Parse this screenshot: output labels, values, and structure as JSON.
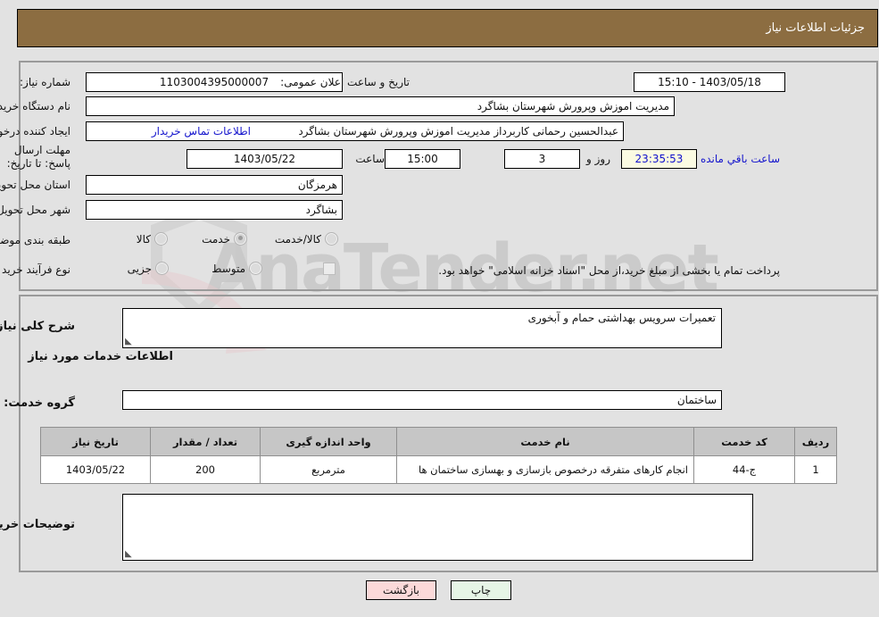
{
  "header": {
    "title": "جزئیات اطلاعات نیاز"
  },
  "watermark": {
    "text": "AnaTender.net"
  },
  "top_form": {
    "need_number_label": "شماره نیاز:",
    "need_number_value": "1103004395000007",
    "announce_label": "تاریخ و ساعت اعلان عمومی:",
    "announce_value": "1403/05/18 - 15:10",
    "buyer_org_label": "نام دستگاه خریدار:",
    "buyer_org_value": "مدیریت اموزش وپرورش شهرستان بشاگرد",
    "creator_label": "ایجاد کننده درخواست:",
    "creator_value": "عبدالحسین رحمانی کاربرداز مدیریت اموزش وپرورش شهرستان بشاگرد",
    "contact_link": "اطلاعات تماس خریدار",
    "deadline_label": "مهلت ارسال پاسخ: تا تاریخ:",
    "deadline_date": "1403/05/22",
    "hour_label": "ساعت",
    "deadline_time": "15:00",
    "days_value": "3",
    "days_label": "روز و",
    "countdown_value": "23:35:53",
    "countdown_label": "ساعت باقي مانده",
    "province_label": "استان محل تحویل:",
    "province_value": "هرمزگان",
    "city_label": "شهر محل تحویل:",
    "city_value": "بشاگرد",
    "category_label": "طبقه بندی موضوعی:",
    "category_options": [
      {
        "label": "کالا",
        "selected": false
      },
      {
        "label": "خدمت",
        "selected": true
      },
      {
        "label": "کالا/خدمت",
        "selected": false
      }
    ],
    "process_label": "نوع فرآیند خرید :",
    "process_options": [
      {
        "label": "جزیی",
        "selected": false
      },
      {
        "label": "متوسط",
        "selected": false
      }
    ],
    "treasury_note": "پرداخت تمام یا بخشی از مبلغ خرید،از محل \"اسناد خزانه اسلامی\" خواهد بود."
  },
  "bottom": {
    "summary_label": "شرح کلی نیاز:",
    "summary_value": "تعمیرات سرویس بهداشتی حمام و آبخوری",
    "services_heading": "اطلاعات خدمات مورد نیاز",
    "service_group_label": "گروه خدمت:",
    "service_group_value": "ساختمان",
    "buyer_notes_label": "توضیحات خریدار:",
    "buyer_notes_value": ""
  },
  "table": {
    "columns": [
      "ردیف",
      "کد خدمت",
      "نام خدمت",
      "واحد اندازه گیری",
      "تعداد / مقدار",
      "تاریخ نیاز"
    ],
    "rows": [
      {
        "row": "1",
        "code": "ج-44",
        "name": "انجام کارهای متفرقه درخصوص بازسازی و بهسازی ساختمان ها",
        "unit": "مترمربع",
        "qty": "200",
        "date": "1403/05/22"
      }
    ]
  },
  "buttons": {
    "print": "چاپ",
    "back": "بازگشت"
  },
  "colors": {
    "header_bar": "#8c6d41",
    "page_bg": "#e2e2e2",
    "link": "#1414cc",
    "timer_bg": "#fbfbe2",
    "print_btn": "#e6f5e6",
    "back_btn": "#fbd9d9",
    "table_header": "#c6c6c6"
  }
}
